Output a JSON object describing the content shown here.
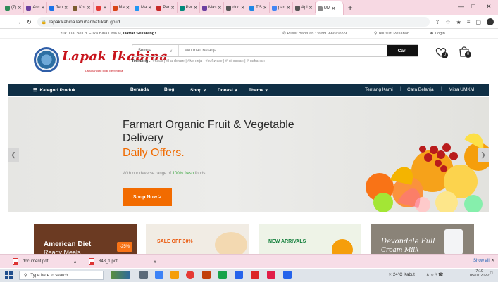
{
  "browser": {
    "tabs": [
      {
        "label": "(7) ",
        "color": "#2e8b57"
      },
      {
        "label": "Acc",
        "color": "#6b3fa0"
      },
      {
        "label": "Ten",
        "color": "#1a73e8"
      },
      {
        "label": "Kor",
        "color": "#7a5c2e"
      },
      {
        "label": "",
        "color": "#e53935"
      },
      {
        "label": "Ma",
        "color": "#d84315"
      },
      {
        "label": "Ma",
        "color": "#2196f3"
      },
      {
        "label": "Per",
        "color": "#c62828"
      },
      {
        "label": "Per",
        "color": "#00897b"
      },
      {
        "label": "Mas",
        "color": "#6b3fa0"
      },
      {
        "label": "doc",
        "color": "#555555"
      },
      {
        "label": "T.S",
        "color": "#1e88e5"
      },
      {
        "label": "pan",
        "color": "#4285f4"
      },
      {
        "label": "Apl",
        "color": "#555555"
      }
    ],
    "active_tab": {
      "label": "UM",
      "color": "#888888"
    },
    "url": "lapakikabina.labuhanbatukab.go.id",
    "new_tab_label": "+"
  },
  "topbar": {
    "left_text": "Yuk Jual Beli di E Ika Bina UMKM, ",
    "left_bold": "Daftar Sekarang!",
    "help": "Pusat Bantuan : 9999 9999 9999",
    "track": "Telusuri Pesanan",
    "login": "Login"
  },
  "brand": {
    "name": "Lapak Ikabina",
    "tagline": "Labuhanbatu Bijak Berbelanja"
  },
  "search": {
    "category": "Semua",
    "placeholder": "Aku mau Belanja...",
    "button": "Cari"
  },
  "trending": {
    "label": "Trending :",
    "items": "#kaos | #hardware | #kemeja | #software | #minuman | #makanan"
  },
  "cart": {
    "wishlist_count": "0",
    "cart_count": "0"
  },
  "nav": {
    "category": "Kategori Produk",
    "items": [
      "Beranda",
      "Blog",
      "Shop",
      "Donasi",
      "Theme"
    ],
    "right": [
      "Tentang Kami",
      "Cara Belanja",
      "Mitra UMKM"
    ]
  },
  "hero": {
    "title": "Farmart Organic Fruit & Vegetable Delivery",
    "offer": "Daily Offers.",
    "desc_prefix": "With our deverse range of ",
    "desc_green": "100% fresh",
    "desc_suffix": " foods.",
    "cta": "Shop Now >"
  },
  "banners": [
    {
      "title": "American Diet",
      "sub": "Ready Meals",
      "badge": "-25%"
    },
    {
      "title": "SALE OFF 30%",
      "sub": ""
    },
    {
      "title": "NEW ARRIVALS",
      "sub": ""
    },
    {
      "title": "Devondale Full",
      "sub": "Cream Milk"
    }
  ],
  "downloads": {
    "files": [
      "document.pdf",
      "848_1.pdf"
    ],
    "show_all": "Show all"
  },
  "taskbar": {
    "search_placeholder": "Type here to search",
    "weather": "24°C  Kabut",
    "time": "7:19",
    "date": "05/07/2022"
  }
}
